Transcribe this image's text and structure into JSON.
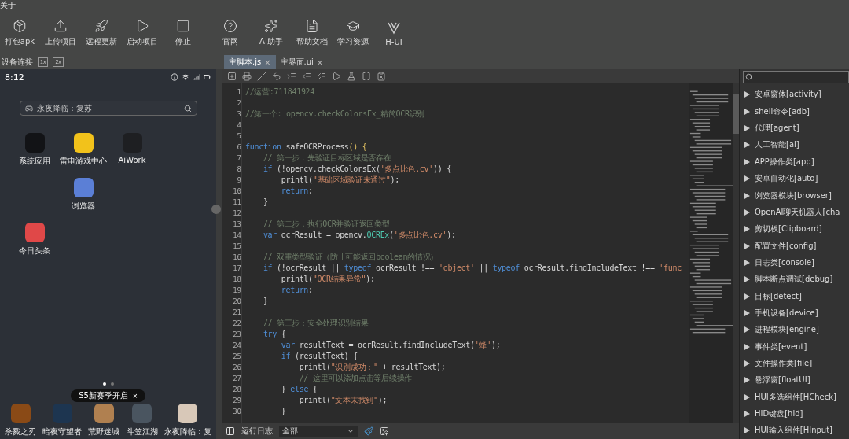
{
  "menu": {
    "items": [
      "关于"
    ]
  },
  "toolbar": [
    {
      "label": "打包apk"
    },
    {
      "label": "上传项目"
    },
    {
      "label": "远程更新"
    },
    {
      "label": "启动项目"
    },
    {
      "label": "停止"
    },
    {
      "label": "官网"
    },
    {
      "label": "AI助手"
    },
    {
      "label": "帮助文档"
    },
    {
      "label": "学习资源"
    },
    {
      "label": "H-UI"
    }
  ],
  "device_panel": {
    "title": "设备连接",
    "zoom_buttons": [
      "1x",
      "2x"
    ],
    "phone": {
      "time": "8:12",
      "search": "永夜降临：复苏",
      "apps": [
        {
          "label": "系统应用",
          "color": "#121316"
        },
        {
          "label": "雷电游戏中心",
          "color": "#f2c21b"
        },
        {
          "label": "AiWork",
          "color": "#1e1f22"
        },
        {
          "label": "浏览器",
          "color": "#5b7fd6"
        },
        {
          "label": "今日头条",
          "color": "#e04848"
        }
      ],
      "page_dots": [
        {
          "selected": true
        },
        {
          "selected": false
        }
      ],
      "toast": {
        "text": "S5新赛季开启",
        "close": "×"
      },
      "dock": [
        {
          "label": "杀戮之刃",
          "color": "#8a4a16"
        },
        {
          "label": "暗夜守望者",
          "color": "#1d3550"
        },
        {
          "label": "荒野迷城",
          "color": "#b08050"
        },
        {
          "label": "斗笠江湖",
          "color": "#4a5560"
        },
        {
          "label": "永夜降临：复",
          "color": "#d8c8b8"
        }
      ]
    }
  },
  "editor": {
    "tabs": [
      {
        "label": "主脚本.js",
        "selected": true,
        "close": "×"
      },
      {
        "label": "主界面.ui",
        "selected": false,
        "close": "×"
      }
    ],
    "lines": [
      {
        "num": "1",
        "tokens": [
          {
            "kind": "comment",
            "text": "//运营:711841924"
          }
        ]
      },
      {
        "num": "2"
      },
      {
        "num": "3",
        "tokens": [
          {
            "kind": "comment",
            "text": "//第一个: opencv.checkColorsEx_精简OCR识别"
          }
        ]
      },
      {
        "num": "4"
      },
      {
        "num": "5"
      },
      {
        "num": "6",
        "tokens": [
          {
            "kind": "keyword",
            "text": "function"
          },
          {
            "kind": "plain",
            "text": " safeOCRProcess"
          },
          {
            "kind": "bracket",
            "text": "() {"
          }
        ]
      },
      {
        "num": "7",
        "tokens": [
          {
            "kind": "comment",
            "text": "    // 第一步：先验证目标区域是否存在"
          }
        ]
      },
      {
        "num": "8",
        "tokens": [
          {
            "kind": "keyword",
            "text": "    if"
          },
          {
            "kind": "plain",
            "text": " (!opencv.checkColorsEx("
          },
          {
            "kind": "string",
            "text": "'多点比色.cv'"
          },
          {
            "kind": "plain",
            "text": ")) {"
          }
        ]
      },
      {
        "num": "9",
        "tokens": [
          {
            "kind": "plain",
            "text": "        printl("
          },
          {
            "kind": "string",
            "text": "\"基础区域验证未通过\""
          },
          {
            "kind": "plain",
            "text": ");"
          }
        ]
      },
      {
        "num": "10",
        "tokens": [
          {
            "kind": "keyword",
            "text": "        return"
          },
          {
            "kind": "plain",
            "text": ";"
          }
        ]
      },
      {
        "num": "11",
        "tokens": [
          {
            "kind": "plain",
            "text": "    }"
          }
        ]
      },
      {
        "num": "12"
      },
      {
        "num": "13",
        "tokens": [
          {
            "kind": "comment",
            "text": "    // 第二步：执行OCR并验证返回类型"
          }
        ]
      },
      {
        "num": "14",
        "tokens": [
          {
            "kind": "keyword",
            "text": "    var"
          },
          {
            "kind": "plain",
            "text": " ocrResult = opencv."
          },
          {
            "kind": "method",
            "text": "OCREx"
          },
          {
            "kind": "plain",
            "text": "("
          },
          {
            "kind": "string",
            "text": "'多点比色.cv'"
          },
          {
            "kind": "plain",
            "text": ");"
          }
        ]
      },
      {
        "num": "15"
      },
      {
        "num": "16",
        "tokens": [
          {
            "kind": "comment",
            "text": "    // 双重类型验证（防止可能返回boolean的情况）"
          }
        ]
      },
      {
        "num": "17",
        "tokens": [
          {
            "kind": "keyword",
            "text": "    if"
          },
          {
            "kind": "plain",
            "text": " (!ocrResult || "
          },
          {
            "kind": "keyword",
            "text": "typeof"
          },
          {
            "kind": "plain",
            "text": " ocrResult !== "
          },
          {
            "kind": "string",
            "text": "'object'"
          },
          {
            "kind": "plain",
            "text": " || "
          },
          {
            "kind": "keyword",
            "text": "typeof"
          },
          {
            "kind": "plain",
            "text": " ocrResult.findIncludeText !== "
          },
          {
            "kind": "string",
            "text": "'func"
          }
        ]
      },
      {
        "num": "18",
        "tokens": [
          {
            "kind": "plain",
            "text": "        printl("
          },
          {
            "kind": "string",
            "text": "\"OCR结果异常\""
          },
          {
            "kind": "plain",
            "text": ");"
          }
        ]
      },
      {
        "num": "19",
        "tokens": [
          {
            "kind": "keyword",
            "text": "        return"
          },
          {
            "kind": "plain",
            "text": ";"
          }
        ]
      },
      {
        "num": "20",
        "tokens": [
          {
            "kind": "plain",
            "text": "    }"
          }
        ]
      },
      {
        "num": "21"
      },
      {
        "num": "22",
        "tokens": [
          {
            "kind": "comment",
            "text": "    // 第三步：安全处理识别结果"
          }
        ]
      },
      {
        "num": "23",
        "tokens": [
          {
            "kind": "keyword",
            "text": "    try"
          },
          {
            "kind": "plain",
            "text": " {"
          }
        ]
      },
      {
        "num": "24",
        "tokens": [
          {
            "kind": "keyword",
            "text": "        var"
          },
          {
            "kind": "plain",
            "text": " resultText = ocrResult.findIncludeText("
          },
          {
            "kind": "string",
            "text": "'蜂'"
          },
          {
            "kind": "plain",
            "text": ");"
          }
        ]
      },
      {
        "num": "25",
        "tokens": [
          {
            "kind": "keyword",
            "text": "        if"
          },
          {
            "kind": "plain",
            "text": " (resultText) {"
          }
        ]
      },
      {
        "num": "26",
        "tokens": [
          {
            "kind": "plain",
            "text": "            printl("
          },
          {
            "kind": "string",
            "text": "\"识别成功：\""
          },
          {
            "kind": "plain",
            "text": " + resultText);"
          }
        ]
      },
      {
        "num": "27",
        "tokens": [
          {
            "kind": "comment",
            "text": "            // 这里可以添加点击等后续操作"
          }
        ]
      },
      {
        "num": "28",
        "tokens": [
          {
            "kind": "plain",
            "text": "        } "
          },
          {
            "kind": "keyword",
            "text": "else"
          },
          {
            "kind": "plain",
            "text": " {"
          }
        ]
      },
      {
        "num": "29",
        "tokens": [
          {
            "kind": "plain",
            "text": "            printl("
          },
          {
            "kind": "string",
            "text": "\"文本未找到\""
          },
          {
            "kind": "plain",
            "text": ");"
          }
        ]
      },
      {
        "num": "30",
        "tokens": [
          {
            "kind": "plain",
            "text": "        }"
          }
        ]
      }
    ],
    "log_bar": {
      "label": "运行日志",
      "filter": "全部"
    }
  },
  "modules": {
    "items": [
      "安卓窗体[activity]",
      "shell命令[adb]",
      "代理[agent]",
      "人工智能[ai]",
      "APP操作类[app]",
      "安卓自动化[auto]",
      "浏览器模块[browser]",
      "OpenAI聊天机器人[cha",
      "剪切板[Clipboard]",
      "配置文件[config]",
      "日志类[console]",
      "脚本断点调试[debug]",
      "目标[detect]",
      "手机设备[device]",
      "进程模块[engine]",
      "事件类[event]",
      "文件操作类[file]",
      "悬浮窗[floatUI]",
      "HUI多选组件[HCheck]",
      "HID键盘[hid]",
      "HUI输入组件[HInput]"
    ]
  }
}
